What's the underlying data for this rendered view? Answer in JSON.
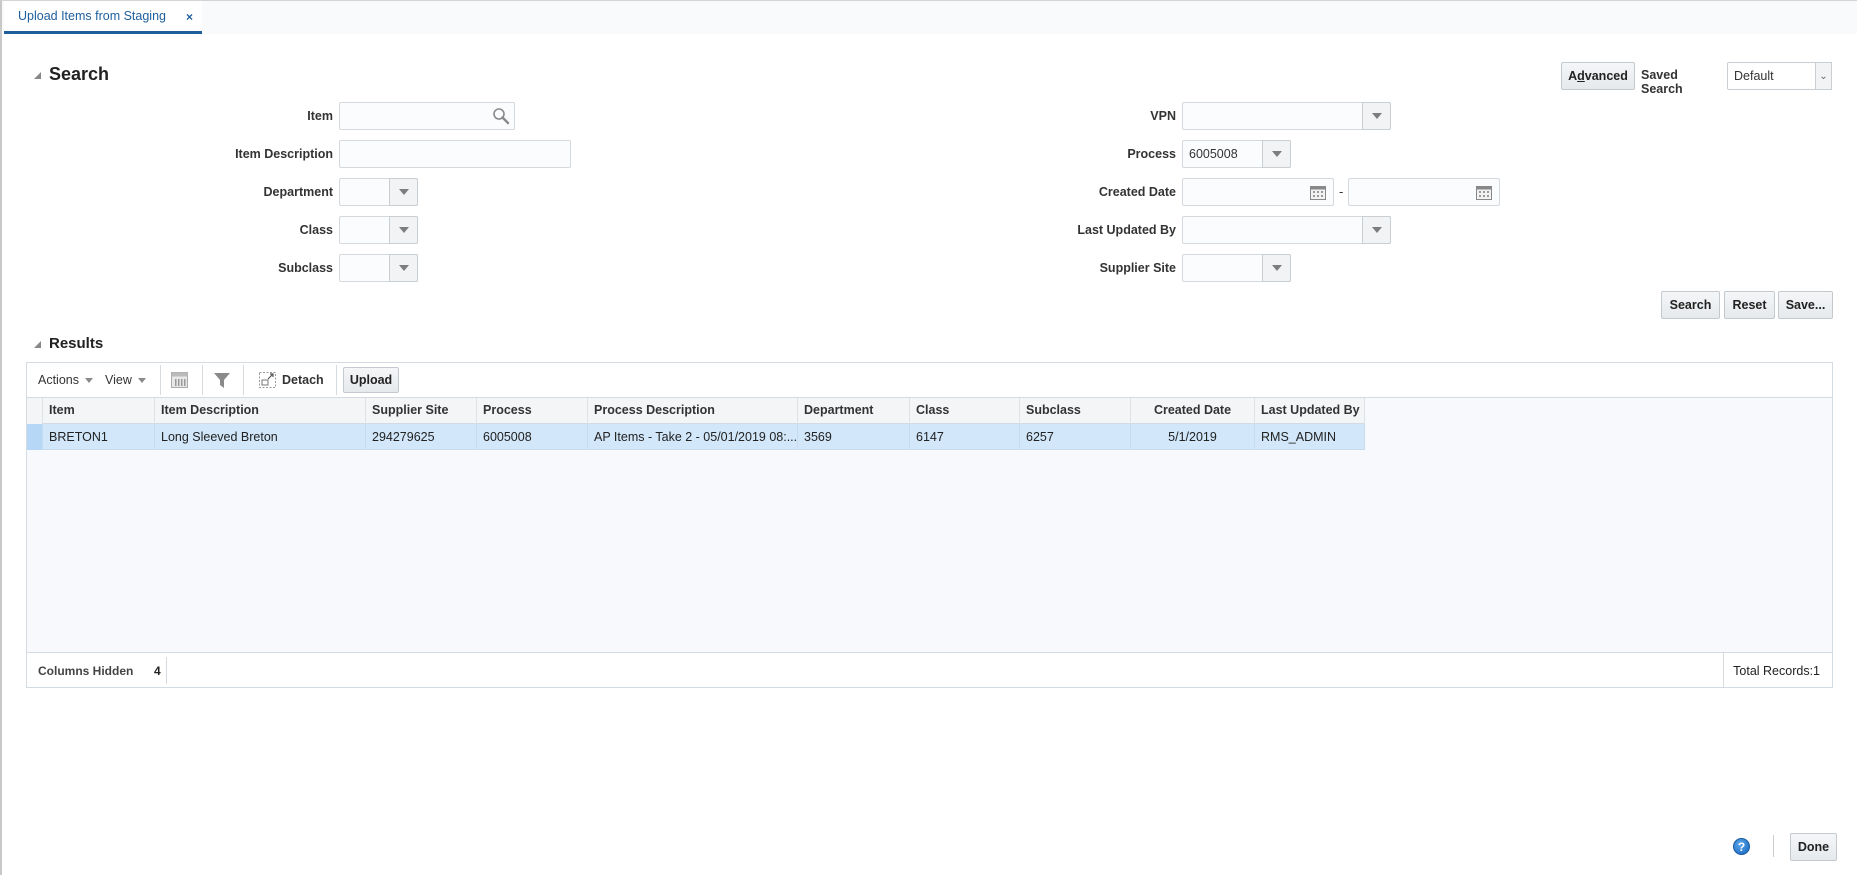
{
  "tab": {
    "label": "Upload Items from Staging",
    "close_label": "×"
  },
  "search": {
    "title": "Search",
    "advanced_label": "Advanced",
    "saved_search_label": "Saved Search",
    "saved_search_value": "Default",
    "fields": {
      "item": {
        "label": "Item",
        "value": ""
      },
      "item_description": {
        "label": "Item Description",
        "value": ""
      },
      "department": {
        "label": "Department",
        "value": ""
      },
      "class": {
        "label": "Class",
        "value": ""
      },
      "subclass": {
        "label": "Subclass",
        "value": ""
      },
      "vpn": {
        "label": "VPN",
        "value": ""
      },
      "process": {
        "label": "Process",
        "value": "6005008"
      },
      "created_date": {
        "label": "Created Date",
        "from": "",
        "to": "",
        "separator": "-"
      },
      "last_updated_by": {
        "label": "Last Updated By",
        "value": ""
      },
      "supplier_site": {
        "label": "Supplier Site",
        "value": ""
      }
    },
    "buttons": {
      "search": "Search",
      "reset": "Reset",
      "save": "Save..."
    }
  },
  "results": {
    "title": "Results",
    "toolbar": {
      "actions_label": "Actions",
      "view_label": "View",
      "export_icon": "export-excel-icon",
      "filter_icon": "filter-icon",
      "detach_label": "Detach",
      "upload_label": "Upload"
    },
    "columns": [
      "Item",
      "Item Description",
      "Supplier Site",
      "Process",
      "Process Description",
      "Department",
      "Class",
      "Subclass",
      "Created Date",
      "Last Updated By"
    ],
    "rows": [
      [
        "BRETON1",
        "Long Sleeved Breton",
        "294279625",
        "6005008",
        "AP Items - Take 2 - 05/01/2019 08:...",
        "3569",
        "6147",
        "6257",
        "5/1/2019",
        "RMS_ADMIN"
      ]
    ],
    "status": {
      "columns_hidden_label": "Columns Hidden",
      "columns_hidden_value": "4",
      "total_records": "Total Records:1"
    }
  },
  "footer": {
    "help_icon": "help-icon",
    "help_glyph": "?",
    "done_label": "Done"
  }
}
